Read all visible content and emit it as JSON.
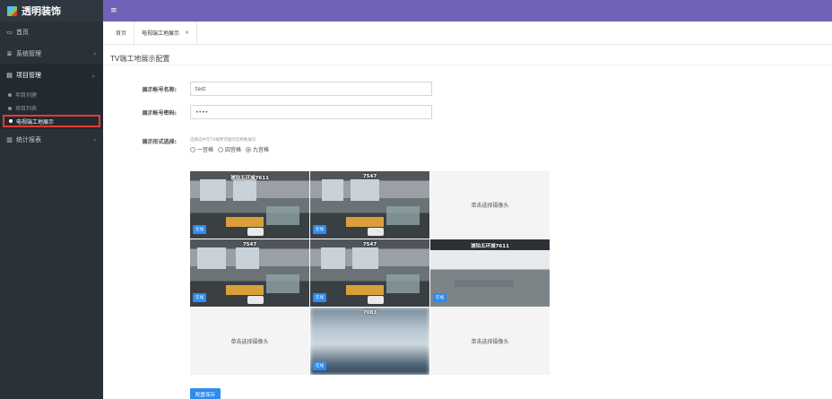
{
  "app": {
    "title": "透明装饰"
  },
  "sidebar": {
    "items": [
      {
        "label": "首页",
        "icon": "monitor-icon"
      },
      {
        "label": "系统管理",
        "icon": "list-icon"
      },
      {
        "label": "项目管理",
        "icon": "document-icon"
      },
      {
        "label": "统计报表",
        "icon": "bar-chart-icon"
      }
    ],
    "sub_items": [
      {
        "label": "项目创建"
      },
      {
        "label": "项目列表"
      },
      {
        "label": "电视端工地展示"
      }
    ]
  },
  "tabs": [
    {
      "label": "首页"
    },
    {
      "label": "电视端工地展示",
      "close": "×"
    }
  ],
  "page": {
    "title": "TV端工地展示配置",
    "account_label": "展示帐号名称:",
    "account_value": "test",
    "password_label": "展示帐号密码:",
    "password_value": "••••",
    "display_label": "展示形式选择:",
    "display_hint": "选择选中在TV端界可能的宫格数展示",
    "options": [
      {
        "label": "一宫格",
        "checked": false
      },
      {
        "label": "四宫格",
        "checked": false
      },
      {
        "label": "九宫格",
        "checked": true
      }
    ],
    "save_label": "配置保存"
  },
  "grid": [
    {
      "title": "琥珀五环城7611",
      "status": "在线",
      "empty": false
    },
    {
      "title": "7547",
      "status": "在线",
      "empty": false
    },
    {
      "placeholder": "单击选择摄像头",
      "empty": true
    },
    {
      "title": "7547",
      "status": "在线",
      "empty": false
    },
    {
      "title": "7547",
      "status": "在线",
      "empty": false
    },
    {
      "title": "琥珀五环城7611",
      "status": "在线",
      "empty": false
    },
    {
      "placeholder": "单击选择摄像头",
      "empty": true
    },
    {
      "title": "7083",
      "status": "在线",
      "empty": false
    },
    {
      "placeholder": "单击选择摄像头",
      "empty": true
    }
  ]
}
